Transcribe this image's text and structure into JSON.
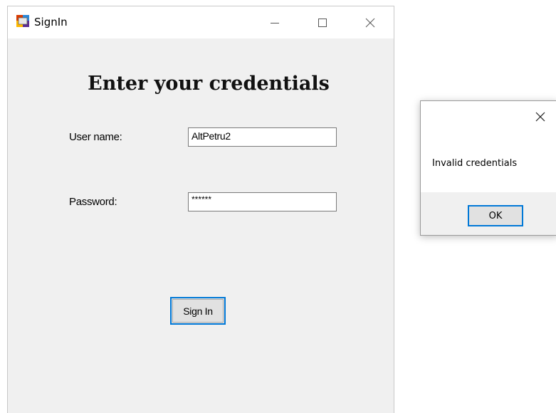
{
  "window": {
    "title": "SignIn",
    "icon": "winforms-app-icon",
    "controls": [
      "minimize-icon",
      "maximize-icon",
      "close-icon"
    ]
  },
  "form": {
    "heading": "Enter your credentials",
    "username_label": "User name:",
    "username_value": "AltPetru2",
    "password_label": "Password:",
    "password_value": "******",
    "signin_label": "Sign In"
  },
  "dialog": {
    "message": "Invalid credentials",
    "ok_label": "OK",
    "close_icon": "close-icon"
  },
  "colors": {
    "focus_border": "#0078d7",
    "window_bg": "#f0f0f0",
    "button_bg": "#e1e1e1"
  }
}
